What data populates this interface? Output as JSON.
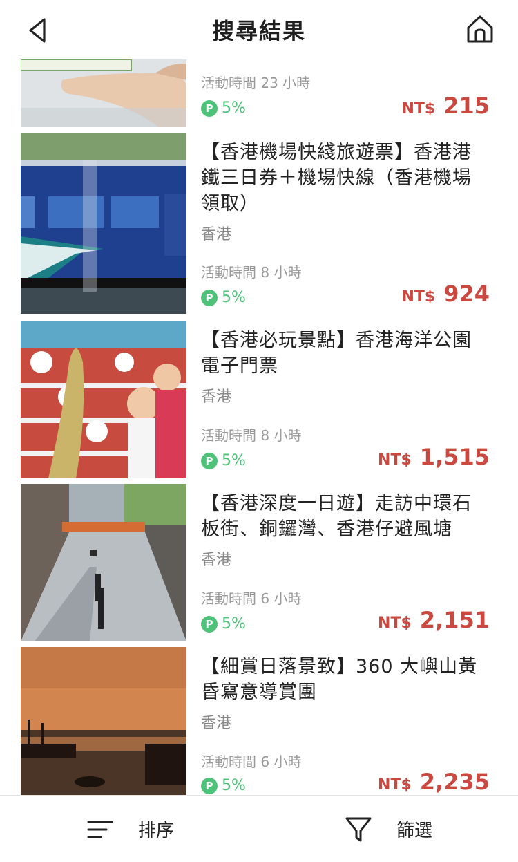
{
  "header": {
    "title": "搜尋結果",
    "back_icon": "chevron-left-icon",
    "home_icon": "home-icon"
  },
  "items": [
    {
      "title": "",
      "location": "",
      "duration": "活動時間 23 小時",
      "reward_badge": "P",
      "reward": "5%",
      "currency": "NT$",
      "price": "215",
      "image": "hand-holding-ticket-card"
    },
    {
      "title": "【香港機場快綫旅遊票】香港港鐵三日券＋機場快線（香港機場領取）",
      "location": "香港",
      "duration": "活動時間 8 小時",
      "reward_badge": "P",
      "reward": "5%",
      "currency": "NT$",
      "price": "924",
      "image": "blue-airport-express-train"
    },
    {
      "title": "【香港必玩景點】香港海洋公園電子門票",
      "location": "香港",
      "duration": "活動時間 8 小時",
      "reward_badge": "P",
      "reward": "5%",
      "currency": "NT$",
      "price": "1,515",
      "image": "children-with-plush-toys"
    },
    {
      "title": "【香港深度一日遊】走訪中環石板街、銅鑼灣、香港仔避風塘",
      "location": "香港",
      "duration": "活動時間 6 小時",
      "reward_badge": "P",
      "reward": "5%",
      "currency": "NT$",
      "price": "2,151",
      "image": "stone-slab-street"
    },
    {
      "title": "【細賞日落景致】360 大嶼山黃昏寫意導賞團",
      "location": "香港",
      "duration": "活動時間 6 小時",
      "reward_badge": "P",
      "reward": "5%",
      "currency": "NT$",
      "price": "2,235",
      "image": "sunset-harbour-boats"
    }
  ],
  "bottom_bar": {
    "sort_label": "排序",
    "sort_icon": "sort-lines-icon",
    "filter_label": "篩選",
    "filter_icon": "filter-funnel-icon"
  },
  "colors": {
    "price": "#c9483f",
    "reward": "#4fc279"
  }
}
